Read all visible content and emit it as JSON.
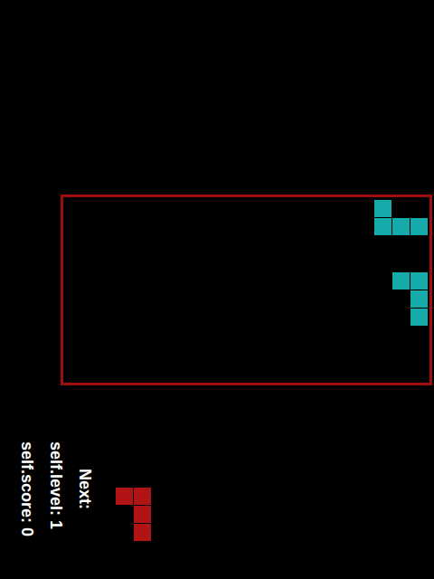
{
  "board": {
    "columns": 20,
    "rows": 10,
    "pieces": [
      {
        "color": "#15abab",
        "cells": [
          [
            17,
            0
          ],
          [
            17,
            1
          ],
          [
            18,
            1
          ],
          [
            19,
            1
          ]
        ]
      },
      {
        "color": "#15abab",
        "cells": [
          [
            18,
            4
          ],
          [
            19,
            4
          ],
          [
            19,
            5
          ],
          [
            19,
            6
          ]
        ]
      }
    ]
  },
  "hud": {
    "score": "self.score: 0",
    "level": "self.level: 1",
    "next_label": "Next:"
  },
  "next_piece": {
    "color": "#b01414",
    "cells": [
      [
        0,
        0
      ],
      [
        1,
        0
      ],
      [
        1,
        1
      ],
      [
        1,
        2
      ]
    ]
  }
}
